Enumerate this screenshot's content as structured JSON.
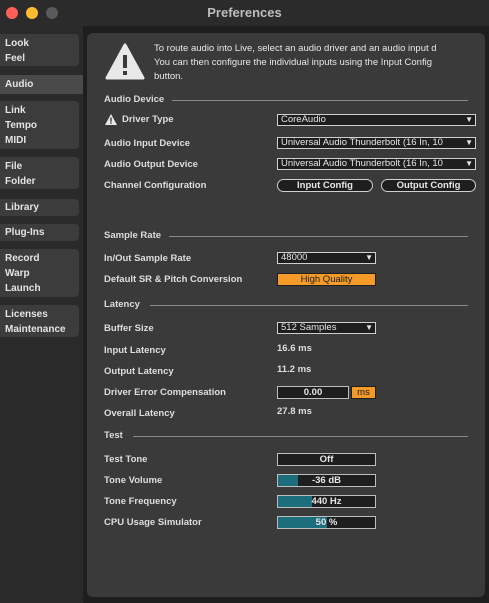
{
  "window": {
    "title": "Preferences"
  },
  "sidebar": {
    "tabs": [
      {
        "lines": [
          "Look",
          "Feel"
        ]
      },
      {
        "lines": [
          "Audio"
        ]
      },
      {
        "lines": [
          "Link",
          "Tempo",
          "MIDI"
        ]
      },
      {
        "lines": [
          "File",
          "Folder"
        ]
      },
      {
        "lines": [
          "Library"
        ]
      },
      {
        "lines": [
          "Plug-Ins"
        ]
      },
      {
        "lines": [
          "Record",
          "Warp",
          "Launch"
        ]
      },
      {
        "lines": [
          "Licenses",
          "Maintenance"
        ]
      }
    ],
    "active": "Audio"
  },
  "info": {
    "lines": [
      "To route audio into Live, select an audio driver and an audio input d",
      "You can then configure the individual inputs using the Input Config",
      "button."
    ]
  },
  "audio_device": {
    "heading": "Audio Device",
    "driver_type_label": "Driver Type",
    "driver_type_value": "CoreAudio",
    "input_device_label": "Audio Input Device",
    "input_device_value": "Universal Audio Thunderbolt (16 In, 10",
    "output_device_label": "Audio Output Device",
    "output_device_value": "Universal Audio Thunderbolt (16 In, 10",
    "channel_config_label": "Channel Configuration",
    "input_config_button": "Input Config",
    "output_config_button": "Output Config"
  },
  "sample_rate": {
    "heading": "Sample Rate",
    "rate_label": "In/Out Sample Rate",
    "rate_value": "48000",
    "conversion_label": "Default SR & Pitch Conversion",
    "conversion_value": "High Quality"
  },
  "latency": {
    "heading": "Latency",
    "buffer_label": "Buffer Size",
    "buffer_value": "512 Samples",
    "input_label": "Input Latency",
    "input_value": "16.6 ms",
    "output_label": "Output Latency",
    "output_value": "11.2 ms",
    "compensation_label": "Driver Error Compensation",
    "compensation_value": "0.00",
    "compensation_unit": "ms",
    "overall_label": "Overall Latency",
    "overall_value": "27.8 ms"
  },
  "test": {
    "heading": "Test",
    "tone_label": "Test Tone",
    "tone_value": "Off",
    "volume_label": "Tone Volume",
    "volume_value": "-36 dB",
    "volume_fill": 0.21,
    "frequency_label": "Tone Frequency",
    "frequency_value": "440 Hz",
    "frequency_fill": 0.35,
    "cpu_label": "CPU Usage Simulator",
    "cpu_value": "50 %",
    "cpu_fill": 0.5
  },
  "colors": {
    "accent_orange": "#f39a29",
    "slider_fill": "#1d6e7d",
    "panel_bg": "#3a3a3a"
  }
}
